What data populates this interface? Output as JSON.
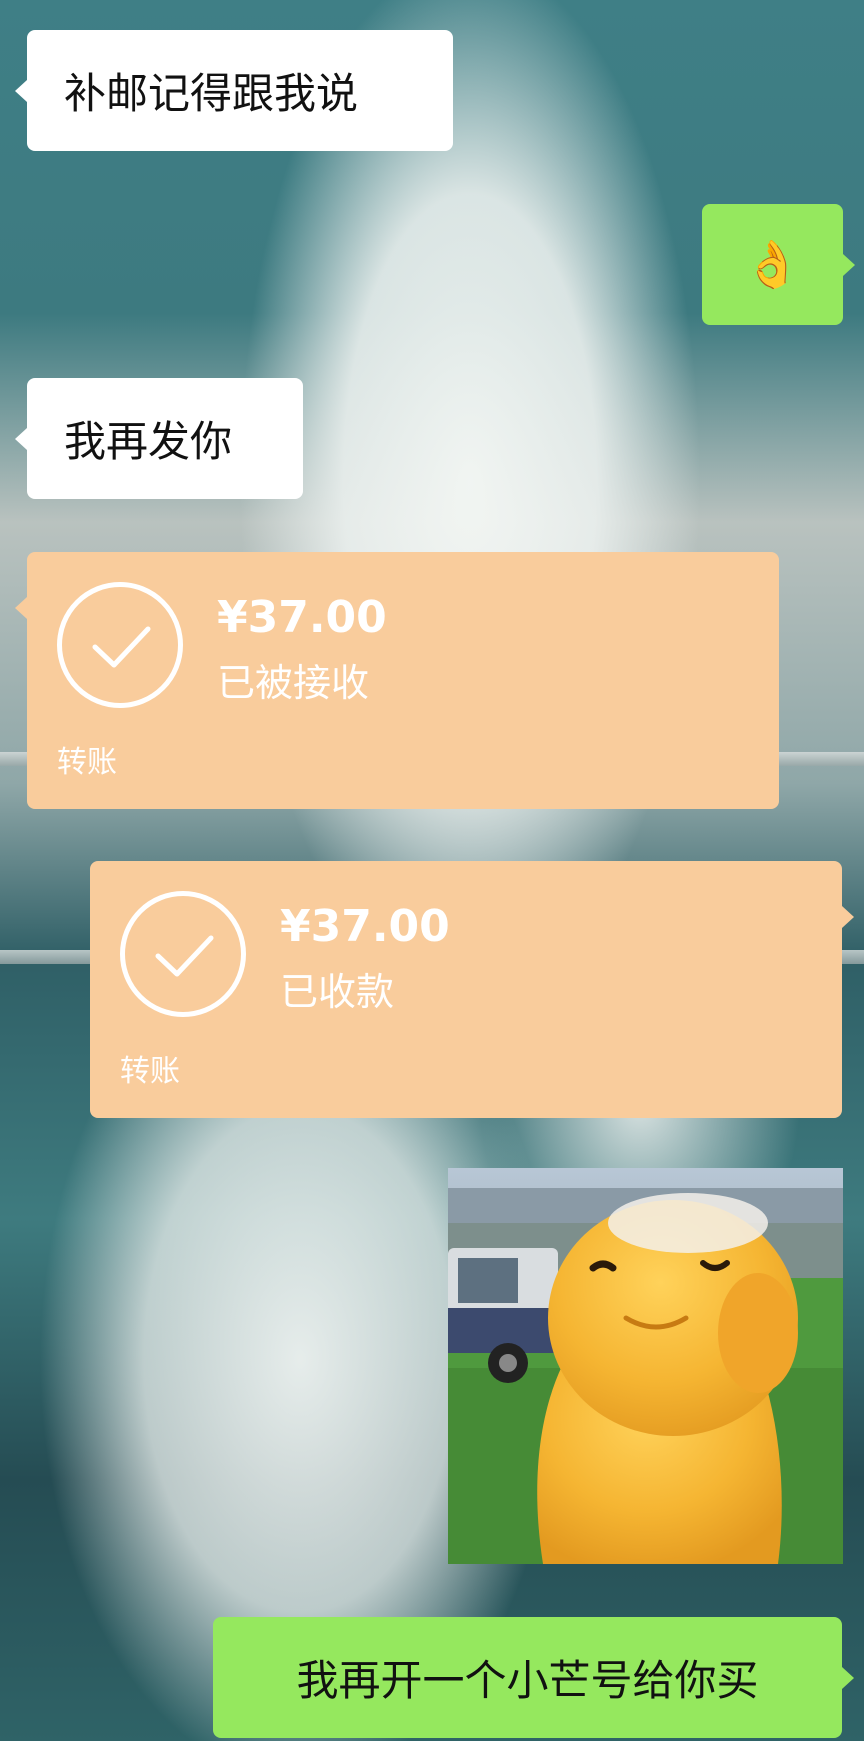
{
  "messages": [
    {
      "side": "left",
      "type": "text",
      "text": "补邮记得跟我说"
    },
    {
      "side": "right",
      "type": "emoji",
      "icon": "ok-hand-icon",
      "text": "👌"
    },
    {
      "side": "left",
      "type": "text",
      "text": "我再发你"
    },
    {
      "side": "left",
      "type": "transfer",
      "amount": "¥37.00",
      "status": "已被接收",
      "label": "转账"
    },
    {
      "side": "right",
      "type": "transfer",
      "amount": "¥37.00",
      "status": "已收款",
      "label": "转账"
    },
    {
      "side": "right",
      "type": "sticker",
      "icon": "mascot-sticker-icon"
    },
    {
      "side": "right",
      "type": "text",
      "text": "我再开一个小芒号给你买"
    }
  ],
  "colors": {
    "bubble_left": "#ffffff",
    "bubble_right": "#95e85e",
    "transfer_card": "#f9cc9c"
  }
}
